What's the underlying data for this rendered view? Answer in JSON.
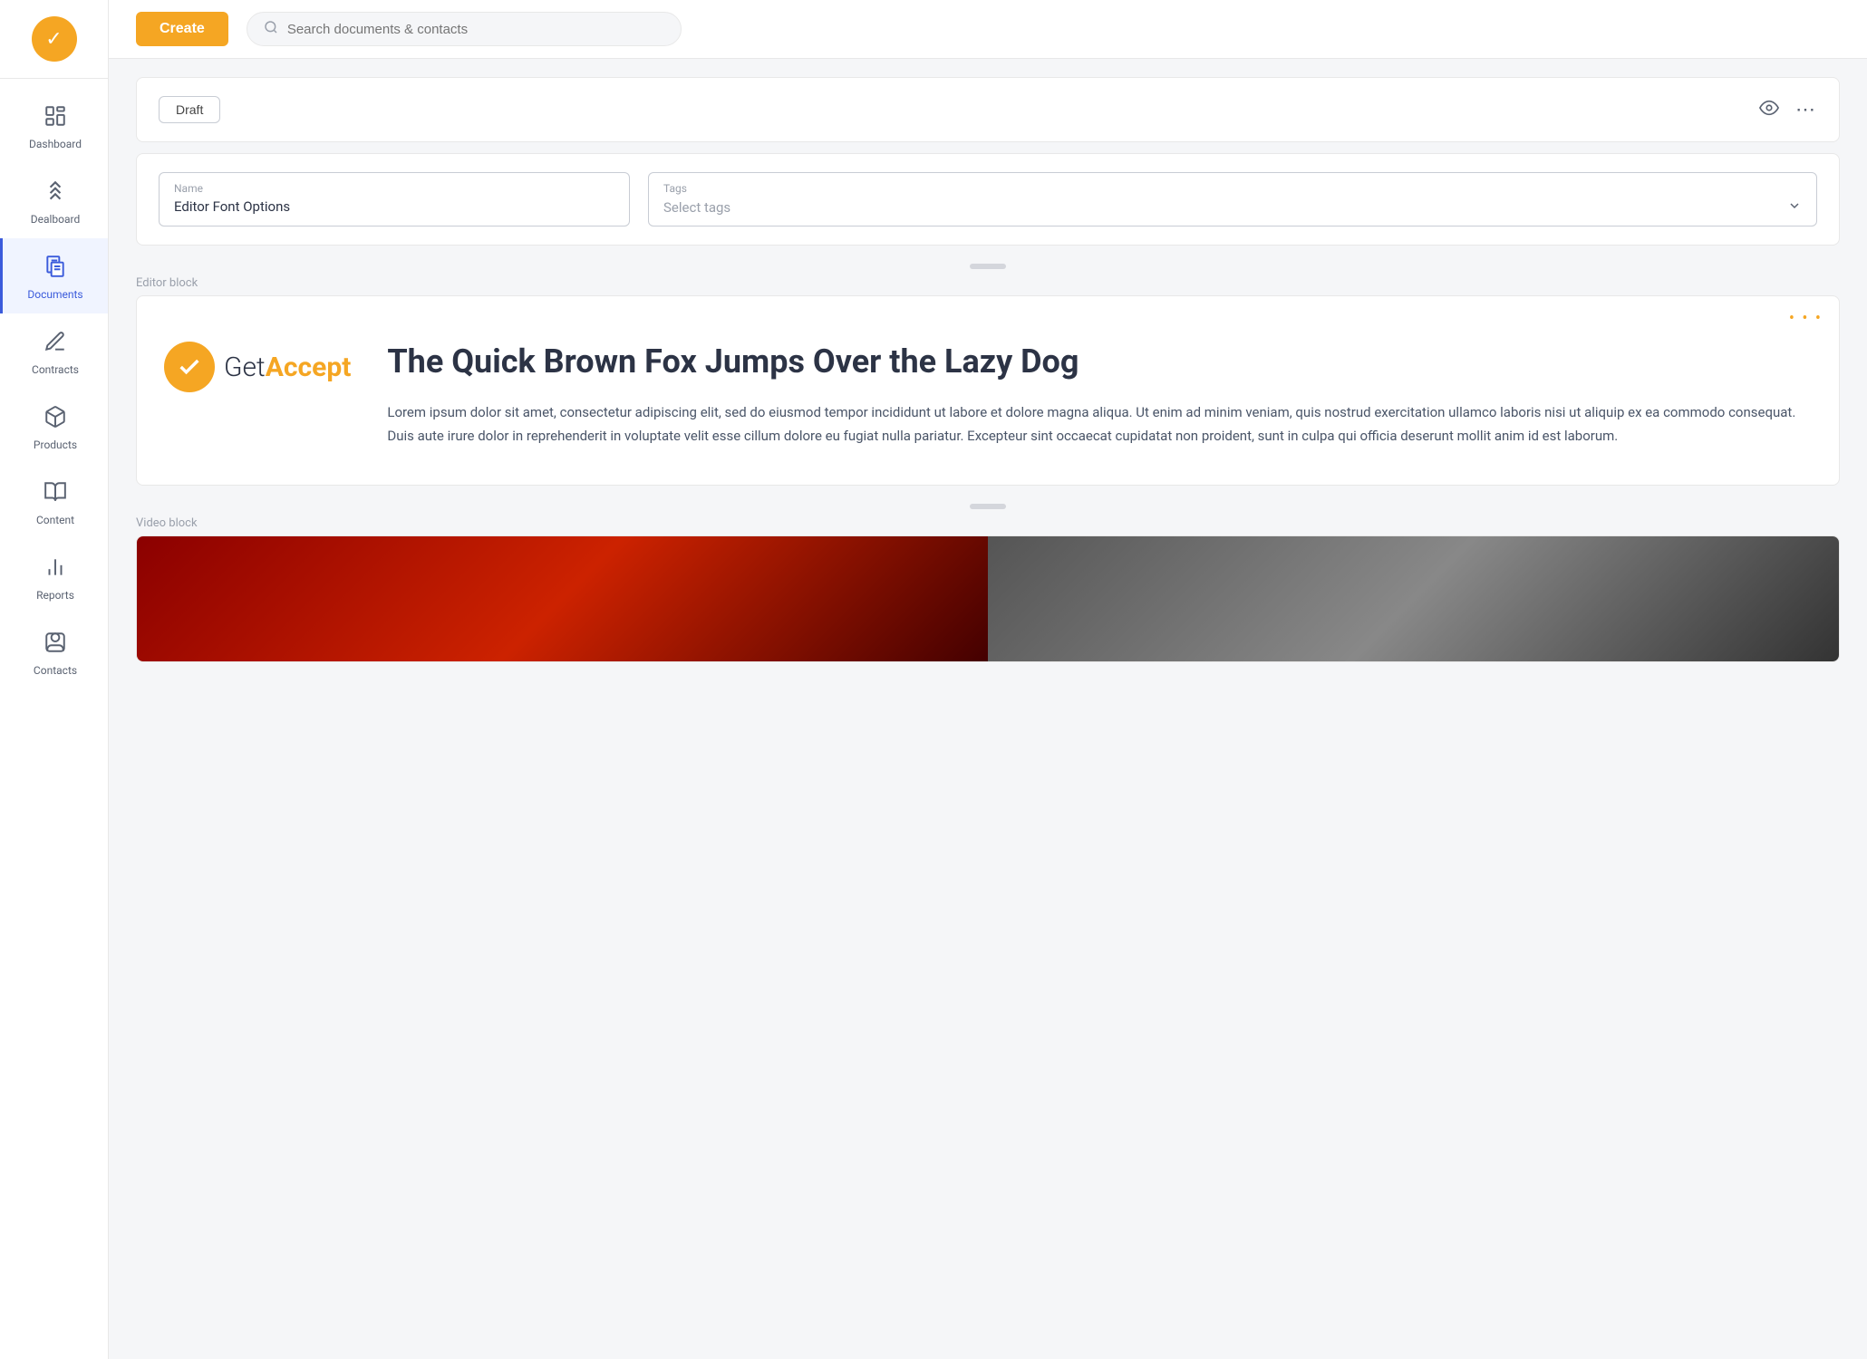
{
  "app": {
    "logo_symbol": "✓",
    "create_button_label": "Create",
    "search_placeholder": "Search documents & contacts"
  },
  "sidebar": {
    "items": [
      {
        "id": "dashboard",
        "label": "Dashboard",
        "icon": "⊞",
        "active": false
      },
      {
        "id": "dealboard",
        "label": "Dealboard",
        "icon": "»",
        "active": false
      },
      {
        "id": "documents",
        "label": "Documents",
        "icon": "📄",
        "active": true
      },
      {
        "id": "contracts",
        "label": "Contracts",
        "icon": "✏️",
        "active": false
      },
      {
        "id": "products",
        "label": "Products",
        "icon": "📦",
        "active": false
      },
      {
        "id": "content",
        "label": "Content",
        "icon": "📚",
        "active": false
      },
      {
        "id": "reports",
        "label": "Reports",
        "icon": "📊",
        "active": false
      },
      {
        "id": "contacts",
        "label": "Contacts",
        "icon": "👤",
        "active": false
      }
    ]
  },
  "doc_header": {
    "draft_label": "Draft",
    "eye_icon": "👁",
    "more_icon": "⋯"
  },
  "fields": {
    "name_label": "Name",
    "name_value": "Editor Font Options",
    "tags_label": "Tags",
    "tags_placeholder": "Select tags"
  },
  "editor_block": {
    "block_label": "Editor block",
    "more_icon": "• • •",
    "heading": "The Quick Brown Fox Jumps Over the Lazy Dog",
    "body_text": "Lorem ipsum dolor sit amet, consectetur adipiscing elit, sed do eiusmod tempor incididunt ut labore et dolore magna aliqua. Ut enim ad minim veniam, quis nostrud exercitation ullamco laboris nisi ut aliquip ex ea commodo consequat. Duis aute irure dolor in reprehenderit in voluptate velit esse cillum dolore eu fugiat nulla pariatur. Excepteur sint occaecat cupidatat non proident, sunt in culpa qui officia deserunt mollit anim id est laborum.",
    "logo_check": "✓",
    "logo_get": "Get",
    "logo_accept": "Accept"
  },
  "video_block": {
    "block_label": "Video block"
  }
}
